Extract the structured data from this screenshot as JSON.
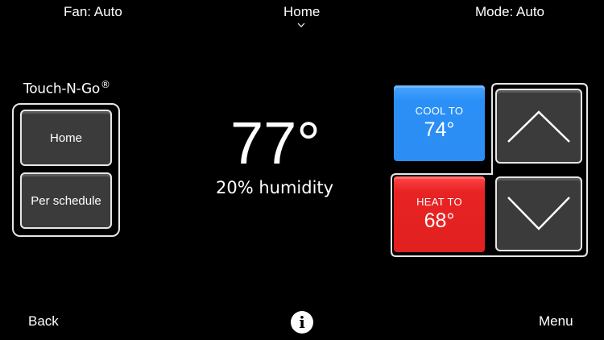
{
  "header": {
    "fan_label": "Fan: Auto",
    "location_label": "Home",
    "mode_label": "Mode: Auto"
  },
  "touch_n_go": {
    "logo_text": "Touch-N-Go",
    "logo_mark": "®",
    "buttons": [
      {
        "label": "Home"
      },
      {
        "label": "Per schedule"
      }
    ]
  },
  "status": {
    "current_temp": "77°",
    "humidity": "20% humidity"
  },
  "setpoints": {
    "cool": {
      "label": "COOL TO",
      "value": "74°",
      "color": "#2c8df3"
    },
    "heat": {
      "label": "HEAT TO",
      "value": "68°",
      "color": "#e12020"
    },
    "up_icon": "chevron-up-icon",
    "down_icon": "chevron-down-icon"
  },
  "footer": {
    "back_label": "Back",
    "info_icon": "i",
    "menu_label": "Menu"
  }
}
